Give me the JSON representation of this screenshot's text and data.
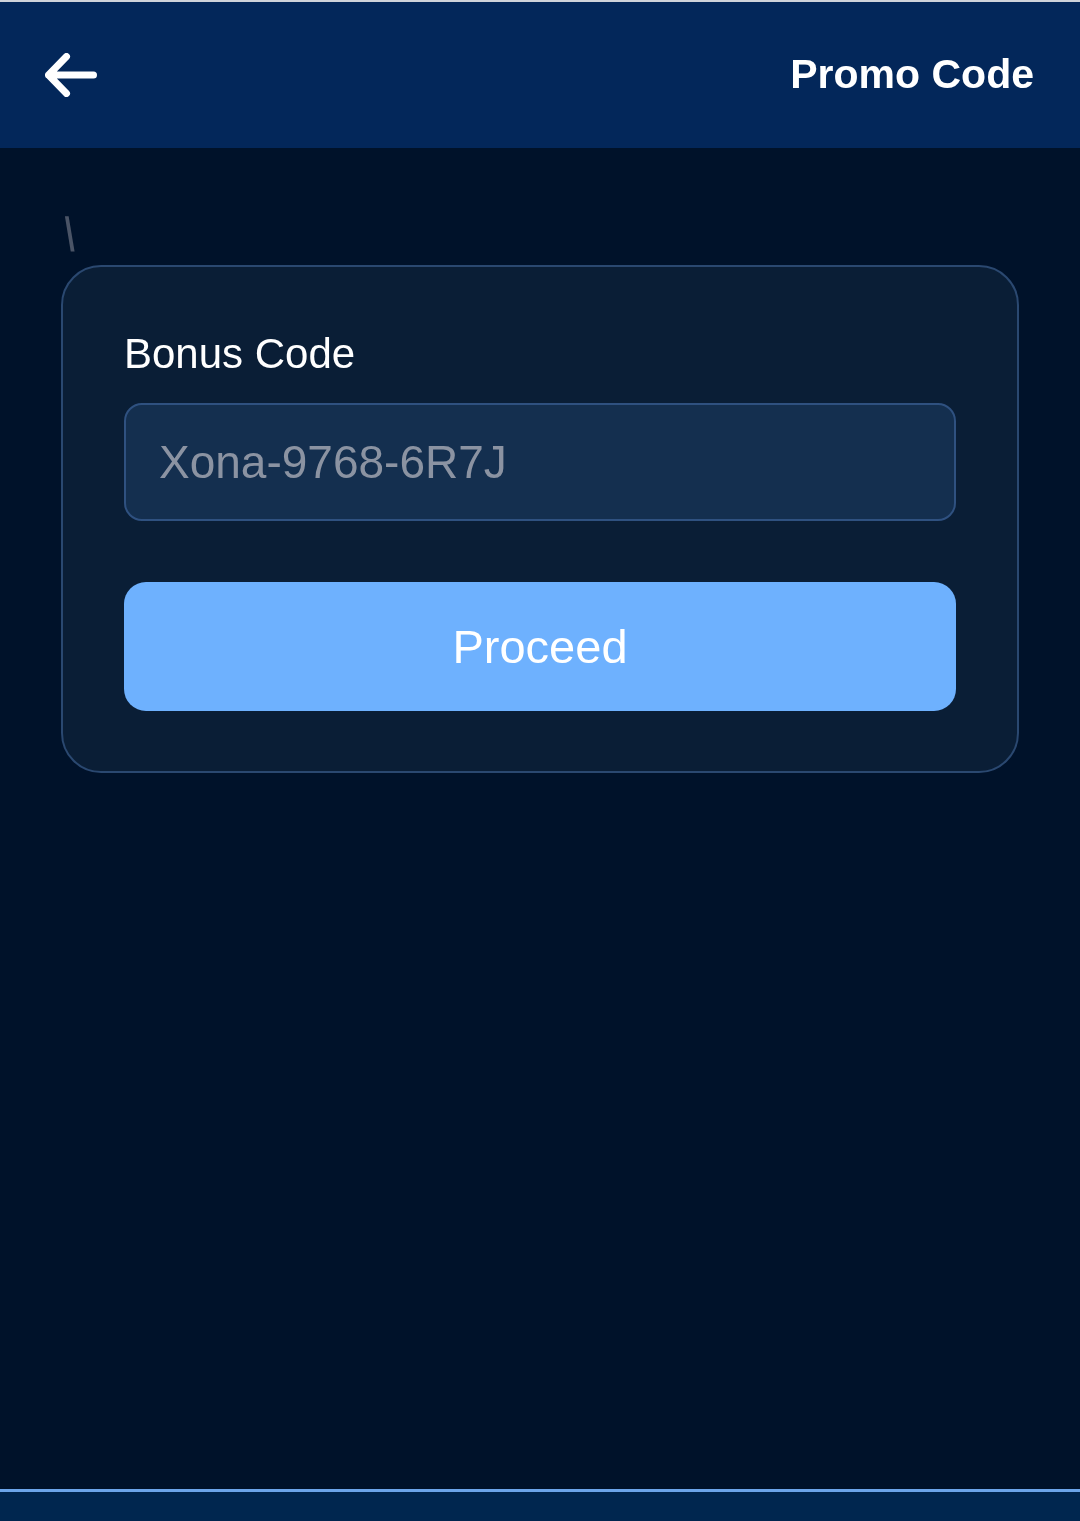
{
  "header": {
    "title": "Promo Code"
  },
  "stray_text": "\\",
  "form": {
    "label": "Bonus Code",
    "input": {
      "placeholder": "Xona-9768-6R7J"
    },
    "button": "Proceed"
  }
}
